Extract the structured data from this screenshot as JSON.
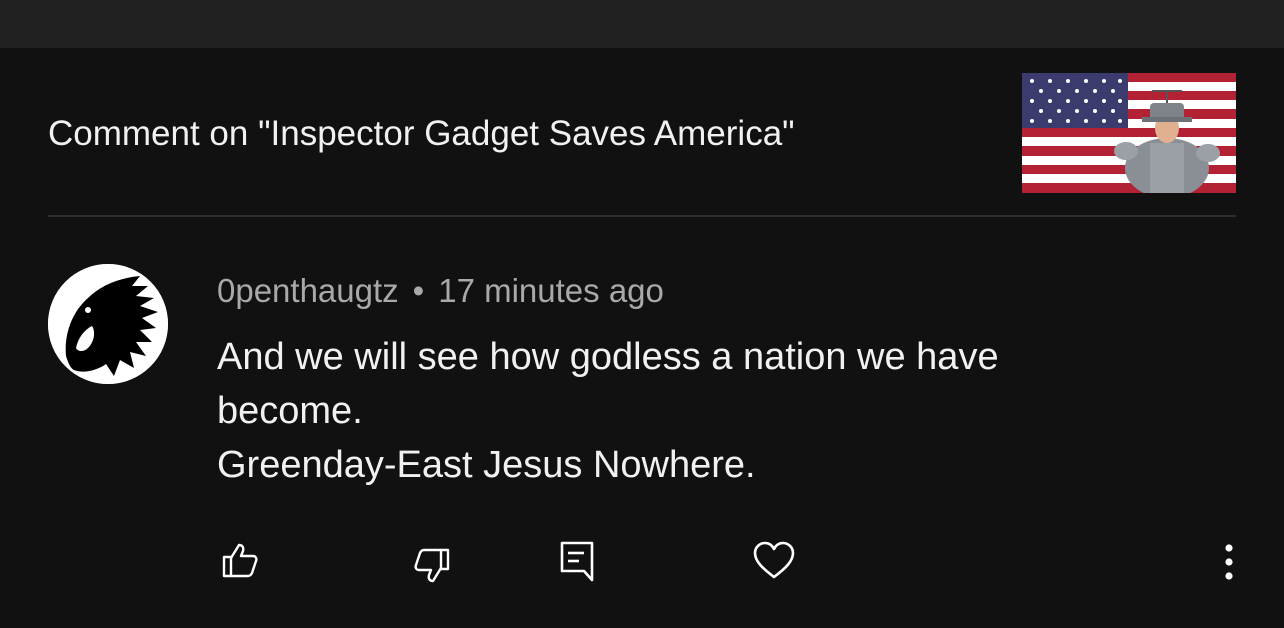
{
  "header": {
    "title": "Comment on \"Inspector Gadget Saves America\"",
    "thumbnail_icon": "video-thumbnail-flag-inspector-gadget"
  },
  "comment": {
    "author": "0penthaugtz",
    "separator": "•",
    "time": "17 minutes ago",
    "text_lines": [
      "And we will see how godless a nation we have",
      "become.",
      "Greenday-East Jesus Nowhere."
    ],
    "avatar_icon": "horse-head-logo-avatar"
  },
  "actions": {
    "like_icon": "thumbs-up-icon",
    "dislike_icon": "thumbs-down-icon",
    "reply_icon": "comment-icon",
    "heart_icon": "heart-icon",
    "more_icon": "more-vert-icon"
  },
  "colors": {
    "background": "#111111",
    "top_bar": "#212121",
    "meta_text": "#a9a9a9",
    "flag_red": "#b22234",
    "flag_blue": "#3c3b6e"
  }
}
